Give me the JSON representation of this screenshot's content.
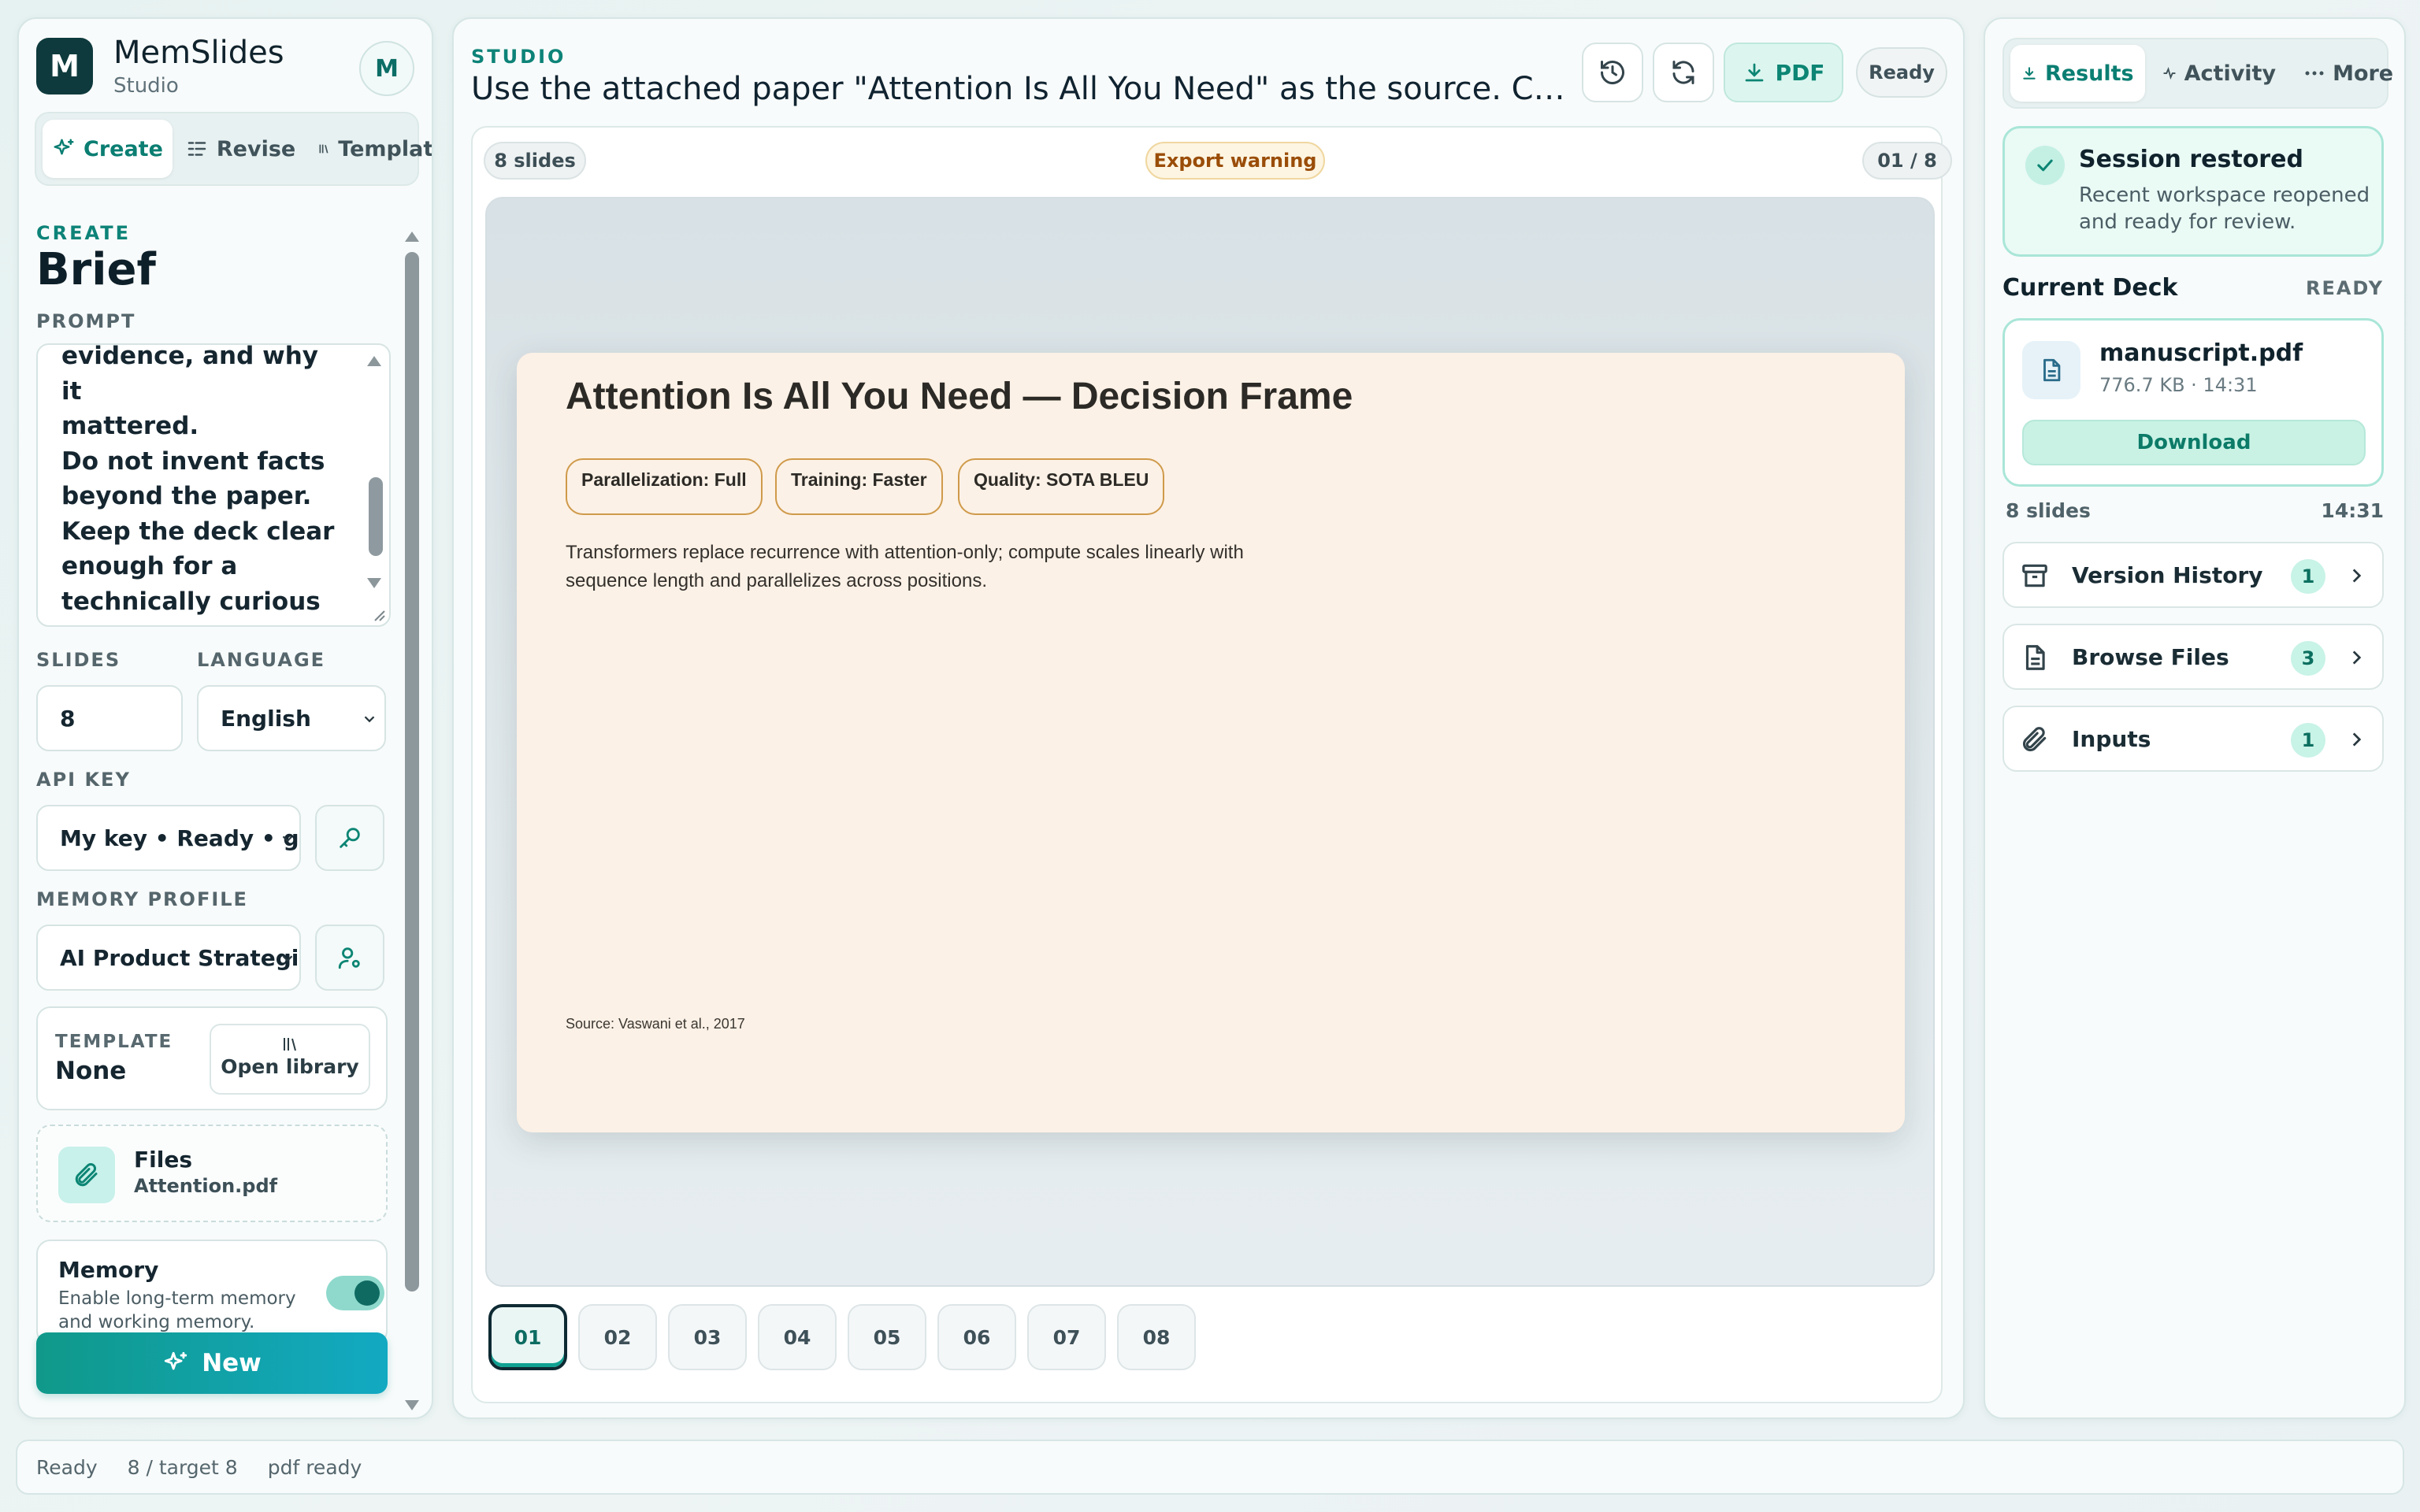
{
  "app": {
    "logo_letter": "M",
    "name": "MemSlides",
    "subtitle": "Studio",
    "avatar_letter": "M"
  },
  "modes": [
    {
      "label": "Create",
      "icon": "sparkles-icon",
      "active": true
    },
    {
      "label": "Revise",
      "icon": "list-edit-icon",
      "active": false
    },
    {
      "label": "Template",
      "icon": "library-icon",
      "active": false
    }
  ],
  "brief": {
    "eyebrow": "CREATE",
    "heading": "Brief",
    "prompt_label": "PROMPT",
    "prompt_text": "evidence, and why it\nmattered.\nDo not invent facts\nbeyond the paper.\nKeep the deck clear\nenough for a\ntechnically curious\naudience.",
    "slides_label": "SLIDES",
    "slides_value": "8",
    "language_label": "LANGUAGE",
    "language_value": "English",
    "api_key_label": "API KEY",
    "api_key_value": "My key • Ready • gpt-",
    "memory_profile_label": "MEMORY PROFILE",
    "memory_profile_value": "AI Product Strategist",
    "template_label": "TEMPLATE",
    "template_value": "None",
    "open_library_label": "Open library",
    "files_title": "Files",
    "files_value": "Attention.pdf",
    "memory_title": "Memory",
    "memory_desc": "Enable long-term memory and working memory.",
    "memory_enabled": true,
    "new_button": "New"
  },
  "studio": {
    "eyebrow": "STUDIO",
    "title": "Use the attached paper \"Attention Is All You Need\" as the source. Create an ...",
    "pdf_label": "PDF",
    "status": "Ready",
    "slide_count": "8 slides",
    "warning": "Export warning",
    "page_indicator": "01 / 8",
    "thumbnails": [
      "01",
      "02",
      "03",
      "04",
      "05",
      "06",
      "07",
      "08"
    ],
    "active_thumbnail": "01"
  },
  "slide": {
    "title": "Attention Is All You Need — Decision Frame",
    "chips": [
      "Parallelization: Full",
      "Training: Faster",
      "Quality: SOTA BLEU"
    ],
    "body": "Transformers replace recurrence with attention-only; compute scales linearly with sequence length and parallelizes across positions.",
    "source": "Source: Vaswani et al., 2017",
    "background": "#fcf1e6",
    "chip_border": "#cf9a4a"
  },
  "results": {
    "tabs": [
      {
        "label": "Results",
        "icon": "download-icon",
        "active": true
      },
      {
        "label": "Activity",
        "icon": "activity-icon",
        "active": false
      },
      {
        "label": "More",
        "icon": "more-icon",
        "active": false
      }
    ],
    "session_title": "Session restored",
    "session_desc": "Recent workspace reopened and ready for review.",
    "current_deck_label": "Current Deck",
    "current_deck_status": "READY",
    "file_name": "manuscript.pdf",
    "file_meta": "776.7 KB · 14:31",
    "download_label": "Download",
    "deck_slides": "8 slides",
    "deck_time": "14:31",
    "rows": [
      {
        "label": "Version History",
        "count": "1",
        "icon": "archive-icon"
      },
      {
        "label": "Browse Files",
        "count": "3",
        "icon": "file-icon"
      },
      {
        "label": "Inputs",
        "count": "1",
        "icon": "paperclip-icon"
      }
    ]
  },
  "statusbar": {
    "state": "Ready",
    "progress": "8 / target 8",
    "export": "pdf ready"
  },
  "colors": {
    "accent": "#0d8378",
    "brand_dark": "#0e3a3d",
    "warning": "#9a4d08"
  }
}
